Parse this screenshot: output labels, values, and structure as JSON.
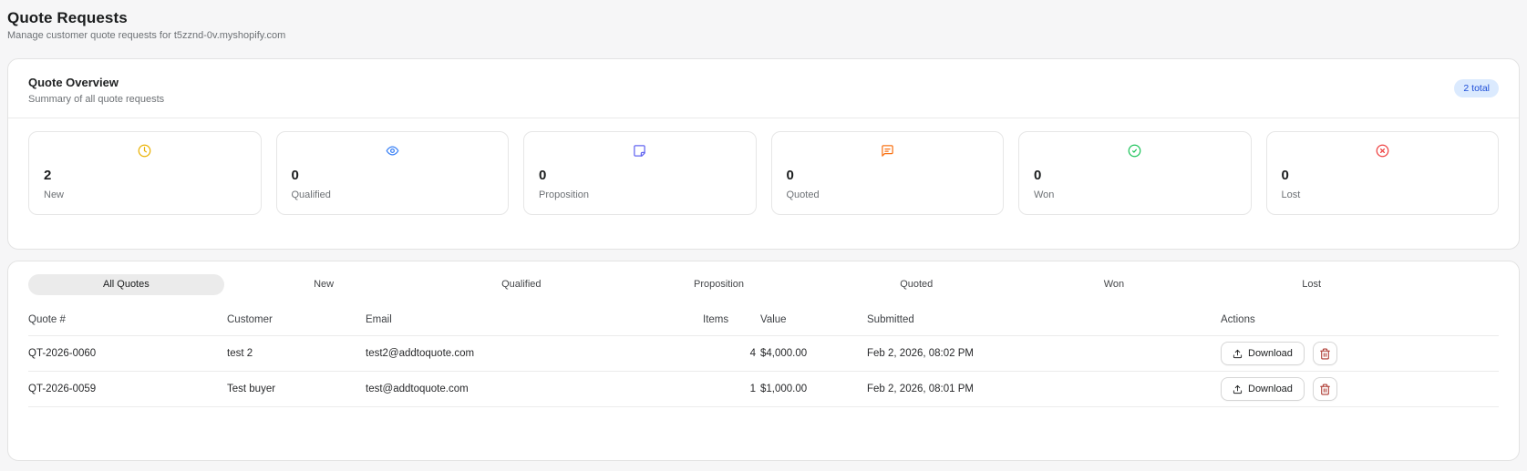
{
  "page": {
    "title": "Quote Requests",
    "subtitle": "Manage customer quote requests for t5zznd-0v.myshopify.com"
  },
  "overview": {
    "title": "Quote Overview",
    "subtitle": "Summary of all quote requests",
    "total_badge": "2 total",
    "stats": [
      {
        "label": "New",
        "value": "2",
        "icon": "clock-icon",
        "color": "#eab308"
      },
      {
        "label": "Qualified",
        "value": "0",
        "icon": "eye-icon",
        "color": "#3b82f6"
      },
      {
        "label": "Proposition",
        "value": "0",
        "icon": "sticky-note-icon",
        "color": "#6366f1"
      },
      {
        "label": "Quoted",
        "value": "0",
        "icon": "message-icon",
        "color": "#f97316"
      },
      {
        "label": "Won",
        "value": "0",
        "icon": "check-circle-icon",
        "color": "#22c55e"
      },
      {
        "label": "Lost",
        "value": "0",
        "icon": "x-circle-icon",
        "color": "#ef4444"
      }
    ]
  },
  "quotes": {
    "tabs": [
      {
        "label": "All Quotes",
        "active": true
      },
      {
        "label": "New"
      },
      {
        "label": "Qualified"
      },
      {
        "label": "Proposition"
      },
      {
        "label": "Quoted"
      },
      {
        "label": "Won"
      },
      {
        "label": "Lost"
      }
    ],
    "columns": [
      "Quote #",
      "Customer",
      "Email",
      "Items",
      "Value",
      "Submitted",
      "Actions"
    ],
    "download_label": "Download",
    "rows": [
      {
        "quote_number": "QT-2026-0060",
        "customer": "test 2",
        "email": "test2@addtoquote.com",
        "items": "4",
        "value": "$4,000.00",
        "submitted": "Feb 2, 2026, 08:02 PM"
      },
      {
        "quote_number": "QT-2026-0059",
        "customer": "Test buyer",
        "email": "test@addtoquote.com",
        "items": "1",
        "value": "$1,000.00",
        "submitted": "Feb 2, 2026, 08:01 PM"
      }
    ]
  }
}
